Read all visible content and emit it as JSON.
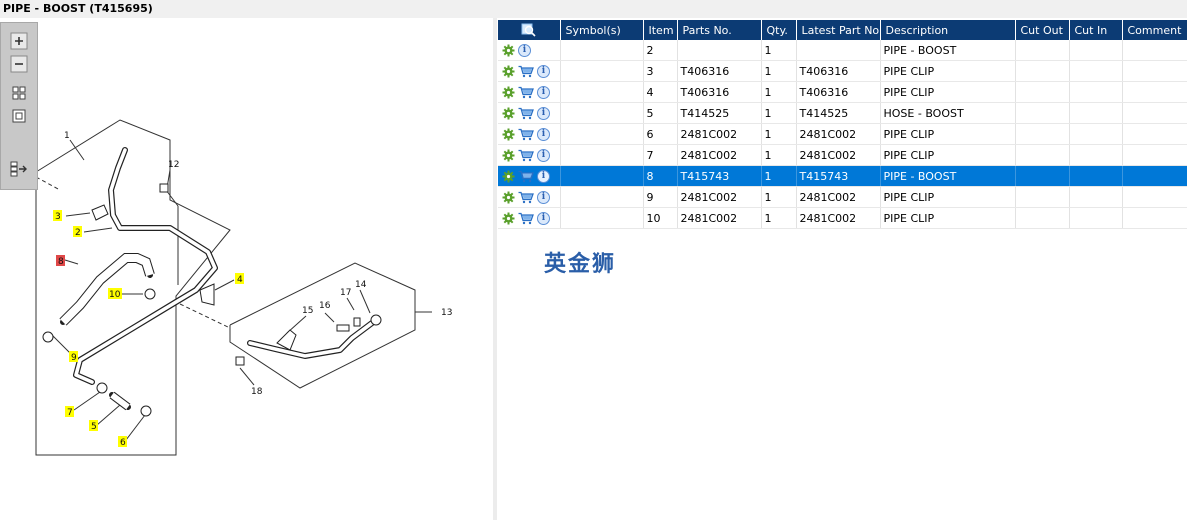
{
  "window": {
    "title": "PIPE - BOOST (T415695)"
  },
  "toolbar": {
    "buttons": [
      {
        "name": "zoom-in-button",
        "icon": "plus-icon"
      },
      {
        "name": "zoom-out-button",
        "icon": "minus-icon"
      },
      {
        "name": "fit-all-button",
        "icon": "grid-icon"
      },
      {
        "name": "fit-window-button",
        "icon": "square-icon"
      },
      {
        "name": "export-button",
        "icon": "export-icon"
      }
    ]
  },
  "diagram": {
    "callouts": [
      "1",
      "2",
      "3",
      "4",
      "6",
      "7",
      "5",
      "6",
      "8",
      "9",
      "10",
      "12",
      "13",
      "14",
      "15",
      "16",
      "17",
      "18"
    ]
  },
  "table": {
    "headers": [
      "",
      "Symbol(s)",
      "Item",
      "Parts No.",
      "Qty.",
      "Latest Part No.",
      "Description",
      "Cut Out",
      "Cut In",
      "Comment"
    ],
    "rows": [
      {
        "item": "2",
        "parts_no": "",
        "qty": "1",
        "latest": "",
        "desc": "PIPE - BOOST",
        "cart": false,
        "selected": false
      },
      {
        "item": "3",
        "parts_no": "T406316",
        "qty": "1",
        "latest": "T406316",
        "desc": "PIPE CLIP",
        "cart": true,
        "selected": false
      },
      {
        "item": "4",
        "parts_no": "T406316",
        "qty": "1",
        "latest": "T406316",
        "desc": "PIPE CLIP",
        "cart": true,
        "selected": false
      },
      {
        "item": "5",
        "parts_no": "T414525",
        "qty": "1",
        "latest": "T414525",
        "desc": "HOSE - BOOST",
        "cart": true,
        "selected": false
      },
      {
        "item": "6",
        "parts_no": "2481C002",
        "qty": "1",
        "latest": "2481C002",
        "desc": "PIPE CLIP",
        "cart": true,
        "selected": false
      },
      {
        "item": "7",
        "parts_no": "2481C002",
        "qty": "1",
        "latest": "2481C002",
        "desc": "PIPE CLIP",
        "cart": true,
        "selected": false
      },
      {
        "item": "8",
        "parts_no": "T415743",
        "qty": "1",
        "latest": "T415743",
        "desc": "PIPE - BOOST",
        "cart": true,
        "selected": true
      },
      {
        "item": "9",
        "parts_no": "2481C002",
        "qty": "1",
        "latest": "2481C002",
        "desc": "PIPE CLIP",
        "cart": true,
        "selected": false
      },
      {
        "item": "10",
        "parts_no": "2481C002",
        "qty": "1",
        "latest": "2481C002",
        "desc": "PIPE CLIP",
        "cart": true,
        "selected": false
      }
    ]
  },
  "watermark": "英金狮",
  "colors": {
    "header_bg": "#0c3b74",
    "selected_row": "#0078d7",
    "highlight_callout": "#ffff00",
    "active_callout": "#d83a3a"
  }
}
